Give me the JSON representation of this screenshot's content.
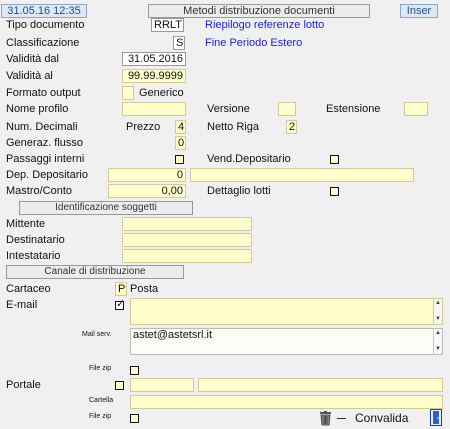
{
  "header": {
    "datetime": "31.05.16 12:35",
    "title": "Metodi distribuzione documenti",
    "mode": "Inser"
  },
  "form": {
    "tipo_documento": {
      "label": "Tipo documento",
      "value": "RRLT",
      "desc": "Riepilogo referenze lotto"
    },
    "classificazione": {
      "label": "Classificazione",
      "value": "S",
      "desc": "Fine Periodo Estero"
    },
    "validita_dal": {
      "label": "Validità dal",
      "value": "31.05.2016"
    },
    "validita_al": {
      "label": "Validità  al",
      "value": "99.99.9999"
    },
    "formato_output": {
      "label": "Formato output",
      "value": "",
      "desc": "Generico"
    },
    "nome_profilo": {
      "label": "Nome profilo",
      "value": ""
    },
    "versione": {
      "label": "Versione",
      "value": ""
    },
    "estensione": {
      "label": "Estensione",
      "value": ""
    },
    "num_decimali": {
      "label": "Num. Decimali",
      "prezzo_label": "Prezzo",
      "prezzo_value": "4",
      "netto_label": "Netto Riga",
      "netto_value": "2"
    },
    "generaz_flusso": {
      "label": "Generaz. flusso",
      "value": "0"
    },
    "passaggi_interni": {
      "label": "Passaggi interni",
      "checked": false
    },
    "vend_depositario": {
      "label": "Vend.Depositario",
      "checked": false
    },
    "dep_depositario": {
      "label": "Dep. Depositario",
      "value": "0",
      "desc": ""
    },
    "mastro_conto": {
      "label": "Mastro/Conto",
      "value": "0,00"
    },
    "dettaglio_lotti": {
      "label": "Dettaglio lotti",
      "checked": false
    }
  },
  "soggetti": {
    "title": "Identificazione soggetti",
    "mittente": {
      "label": "Mittente",
      "value": ""
    },
    "destinatario": {
      "label": "Destinatario",
      "value": ""
    },
    "intestatario": {
      "label": "Intestatario",
      "value": ""
    }
  },
  "canale": {
    "title": "Canale di distribuzione",
    "cartaceo": {
      "label": "Cartaceo",
      "value": "P",
      "desc": "Posta"
    },
    "email": {
      "label": "E-mail",
      "checked": true,
      "value": ""
    },
    "mail_serv": {
      "label": "Mail serv.",
      "value": "astet@astetsrl.it"
    },
    "file_zip_1": {
      "label": "File zip",
      "checked": false
    },
    "portale": {
      "label": "Portale",
      "checked": false,
      "value1": "",
      "value2": ""
    },
    "cartella": {
      "label": "Cartella",
      "value": ""
    },
    "file_zip_2": {
      "label": "File zip",
      "checked": false
    }
  },
  "footer": {
    "convalida_label": "Convalida"
  },
  "icons": {
    "trash": "trash-icon",
    "door": "door-icon"
  }
}
